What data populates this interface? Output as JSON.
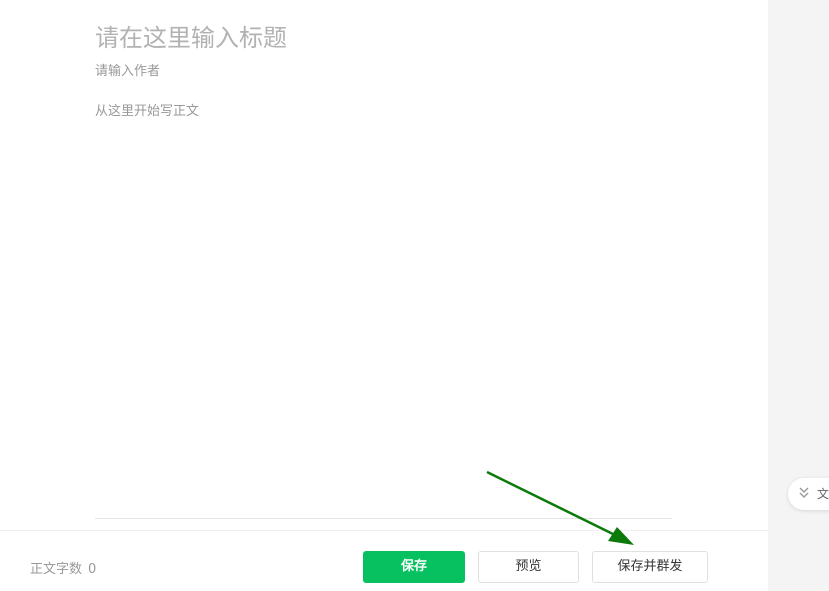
{
  "editor": {
    "title_placeholder": "请在这里输入标题",
    "author_placeholder": "请输入作者",
    "body_placeholder": "从这里开始写正文"
  },
  "toolbar": {
    "word_count_label": "正文字数",
    "word_count_value": "0",
    "save_label": "保存",
    "preview_label": "预览",
    "publish_label": "保存并群发"
  },
  "side_panel": {
    "tab_label": "文",
    "tab_icon": "double-chevron-down-icon"
  },
  "annotation": {
    "arrow_color": "#0b7a0b"
  },
  "colors": {
    "primary_green": "#07c160",
    "panel_background": "#f4f4f5"
  }
}
